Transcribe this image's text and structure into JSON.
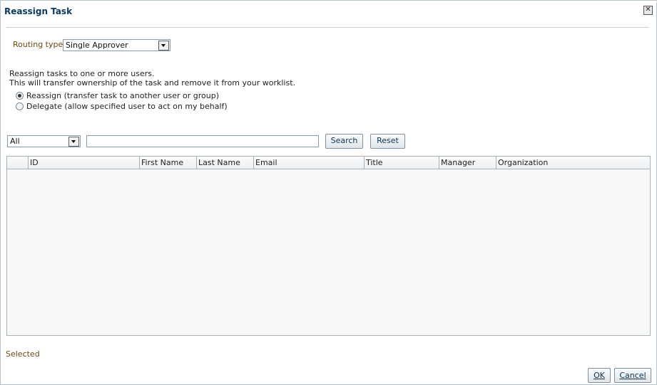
{
  "dialog": {
    "title": "Reassign Task",
    "close_icon": "close-icon"
  },
  "routing": {
    "label": "Routing type",
    "selected": "Single Approver"
  },
  "instructions": {
    "line1": "Reassign tasks to one or more users.",
    "line2": "This will transfer ownership of the task and remove it from your worklist."
  },
  "options": [
    {
      "label": "Reassign (transfer task to another user or group)",
      "checked": true
    },
    {
      "label": "Delegate (allow specified user to act on my behalf)",
      "checked": false
    }
  ],
  "search": {
    "filter_selected": "All",
    "query": "",
    "search_label": "Search",
    "reset_label": "Reset"
  },
  "table": {
    "columns": [
      "ID",
      "First Name",
      "Last Name",
      "Email",
      "Title",
      "Manager",
      "Organization"
    ],
    "rows": []
  },
  "selected_label": "Selected",
  "footer": {
    "ok_label": "OK",
    "cancel_label": "Cancel"
  }
}
